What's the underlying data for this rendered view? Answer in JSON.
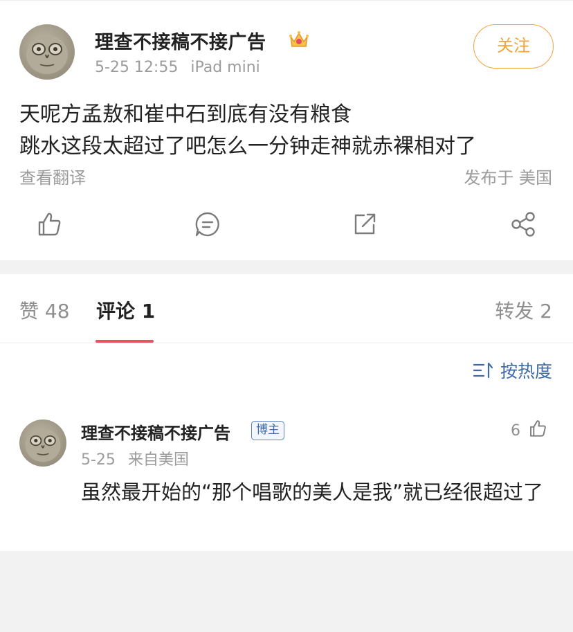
{
  "post": {
    "author": "理查不接稿不接广告",
    "author_badge_icon": "crown-icon",
    "date": "5-25 12:55",
    "device": "iPad mini",
    "follow_label": "关注",
    "text_lines": [
      "天呢方孟敖和崔中石到底有没有粮食",
      "跳水这段太超过了吧怎么一分钟走神就赤裸相对了"
    ],
    "translate_label": "查看翻译",
    "location": "发布于 美国",
    "actions": [
      "like-icon",
      "comment-icon",
      "repost-icon",
      "share-icon"
    ]
  },
  "tabs": {
    "likes": "赞 48",
    "comments": "评论 1",
    "reposts": "转发 2",
    "active": "comments"
  },
  "sort": {
    "label": "按热度",
    "icon": "sort-icon"
  },
  "comment": {
    "author": "理查不接稿不接广告",
    "badge": "博主",
    "date": "5-25",
    "source": "来自美国",
    "like_count": "6",
    "text": "虽然最开始的“那个唱歌的美人是我”就已经很超过了"
  },
  "colors": {
    "follow": "#f2a341",
    "link_blue": "#3f6aa8",
    "tab_underline": "#e8525e",
    "muted_text": "#9c9c9c",
    "background": "#f2f2f2"
  }
}
